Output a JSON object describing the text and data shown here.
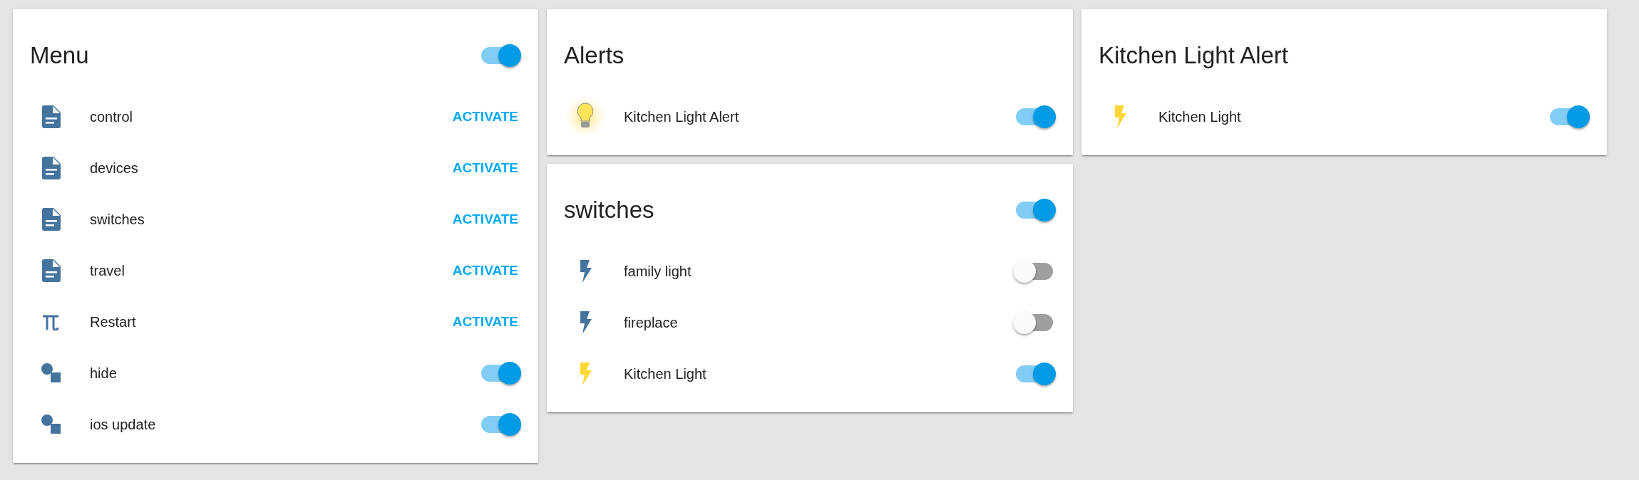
{
  "columns": [
    {
      "cards": [
        {
          "title": "Menu",
          "toggle": {
            "on": true
          },
          "rows": [
            {
              "kind": "script",
              "name": "control",
              "action": "ACTIVATE"
            },
            {
              "kind": "script",
              "name": "devices",
              "action": "ACTIVATE"
            },
            {
              "kind": "script",
              "name": "switches",
              "action": "ACTIVATE"
            },
            {
              "kind": "script",
              "name": "travel",
              "action": "ACTIVATE"
            },
            {
              "kind": "restart",
              "name": "Restart",
              "action": "ACTIVATE"
            },
            {
              "kind": "boolean",
              "name": "hide",
              "on": true
            },
            {
              "kind": "boolean",
              "name": "ios update",
              "on": true
            }
          ]
        }
      ]
    },
    {
      "cards": [
        {
          "title": "Alerts",
          "rows": [
            {
              "kind": "alert",
              "name": "Kitchen Light Alert",
              "on": true
            }
          ]
        },
        {
          "title": "switches",
          "toggle": {
            "on": true
          },
          "rows": [
            {
              "kind": "light",
              "name": "family light",
              "on": false
            },
            {
              "kind": "light",
              "name": "fireplace",
              "on": false
            },
            {
              "kind": "light",
              "name": "Kitchen Light",
              "on": true
            }
          ]
        }
      ]
    },
    {
      "cards": [
        {
          "title": "Kitchen Light Alert",
          "rows": [
            {
              "kind": "light",
              "name": "Kitchen Light",
              "on": true
            }
          ]
        }
      ]
    }
  ]
}
